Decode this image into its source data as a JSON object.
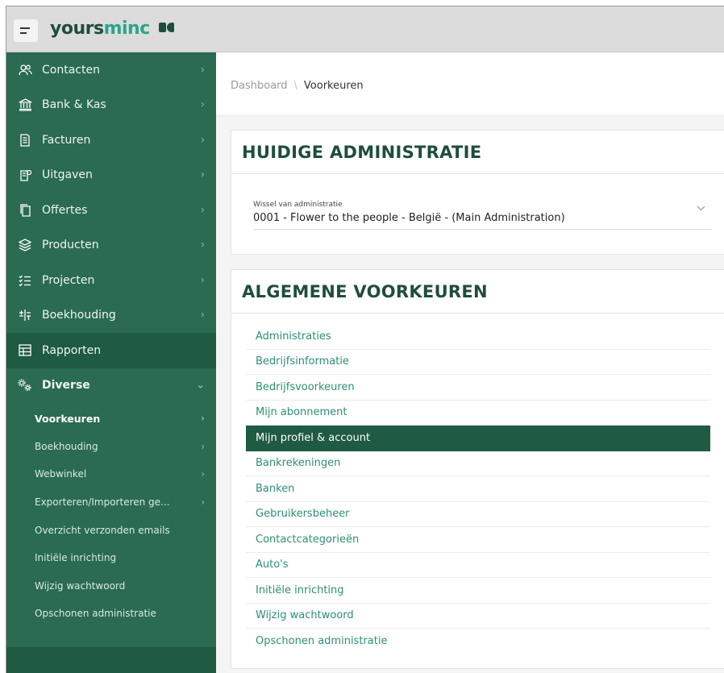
{
  "brand": {
    "part1": "yours",
    "part2": "minc"
  },
  "sidebar": {
    "items": [
      {
        "label": "Contacten",
        "icon": "users-icon"
      },
      {
        "label": "Bank & Kas",
        "icon": "bank-icon"
      },
      {
        "label": "Facturen",
        "icon": "invoice-icon"
      },
      {
        "label": "Uitgaven",
        "icon": "expenses-icon"
      },
      {
        "label": "Offertes",
        "icon": "quote-icon"
      },
      {
        "label": "Producten",
        "icon": "products-icon"
      },
      {
        "label": "Projecten",
        "icon": "projects-icon"
      },
      {
        "label": "Boekhouding",
        "icon": "accounting-icon"
      },
      {
        "label": "Rapporten",
        "icon": "reports-icon"
      }
    ],
    "diverse": {
      "label": "Diverse",
      "icon": "gears-icon"
    },
    "sub_items": [
      {
        "label": "Voorkeuren",
        "active": true,
        "has_chevron": true
      },
      {
        "label": "Boekhouding",
        "has_chevron": true
      },
      {
        "label": "Webwinkel",
        "has_chevron": true
      },
      {
        "label": "Exporteren/Importeren ge...",
        "has_chevron": true
      },
      {
        "label": "Overzicht verzonden emails"
      },
      {
        "label": "Initiële inrichting"
      },
      {
        "label": "Wijzig wachtwoord"
      },
      {
        "label": "Opschonen administratie"
      }
    ]
  },
  "breadcrumb": {
    "root": "Dashboard",
    "separator": "\\",
    "current": "Voorkeuren"
  },
  "current_admin": {
    "title": "HUIDIGE ADMINISTRATIE",
    "select_label": "Wissel van administratie",
    "select_value": "0001 - Flower to the people - België - (Main Administration)"
  },
  "general_prefs": {
    "title": "ALGEMENE VOORKEUREN",
    "items": [
      "Administraties",
      "Bedrijfsinformatie",
      "Bedrijfsvoorkeuren",
      "Mijn abonnement",
      "Mijn profiel & account",
      "Bankrekeningen",
      "Banken",
      "Gebruikersbeheer",
      "Contactcategorieën",
      "Auto's",
      "Initiële inrichting",
      "Wijzig wachtwoord",
      "Opschonen administratie"
    ],
    "active_index": 4
  },
  "colors": {
    "sidebar": "#2a6b52",
    "sidebar_dark": "#1f5a43",
    "accent": "#2c8f76",
    "title": "#1f4d3c"
  }
}
